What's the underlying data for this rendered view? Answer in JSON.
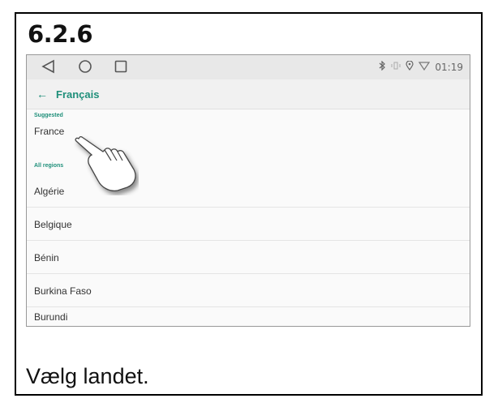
{
  "step": {
    "number": "6.2.6"
  },
  "statusbar": {
    "time": "01:19",
    "icons": [
      "bluetooth-icon",
      "vibrate-icon",
      "location-icon",
      "wifi-icon"
    ]
  },
  "navigation": {
    "buttons": [
      "back-triangle-icon",
      "home-circle-icon",
      "recents-square-icon"
    ]
  },
  "appbar": {
    "back_icon": "arrow-left-icon",
    "title": "Français"
  },
  "list": {
    "suggested_label": "Suggested",
    "suggested": [
      "France"
    ],
    "all_regions_label": "All regions",
    "regions": [
      "Algérie",
      "Belgique",
      "Bénin",
      "Burkina Faso",
      "Burundi"
    ]
  },
  "caption": "Vælg landet.",
  "colors": {
    "accent": "#1f8f7a",
    "navbar": "#e8e8e8",
    "appbar": "#f1f1f1"
  }
}
